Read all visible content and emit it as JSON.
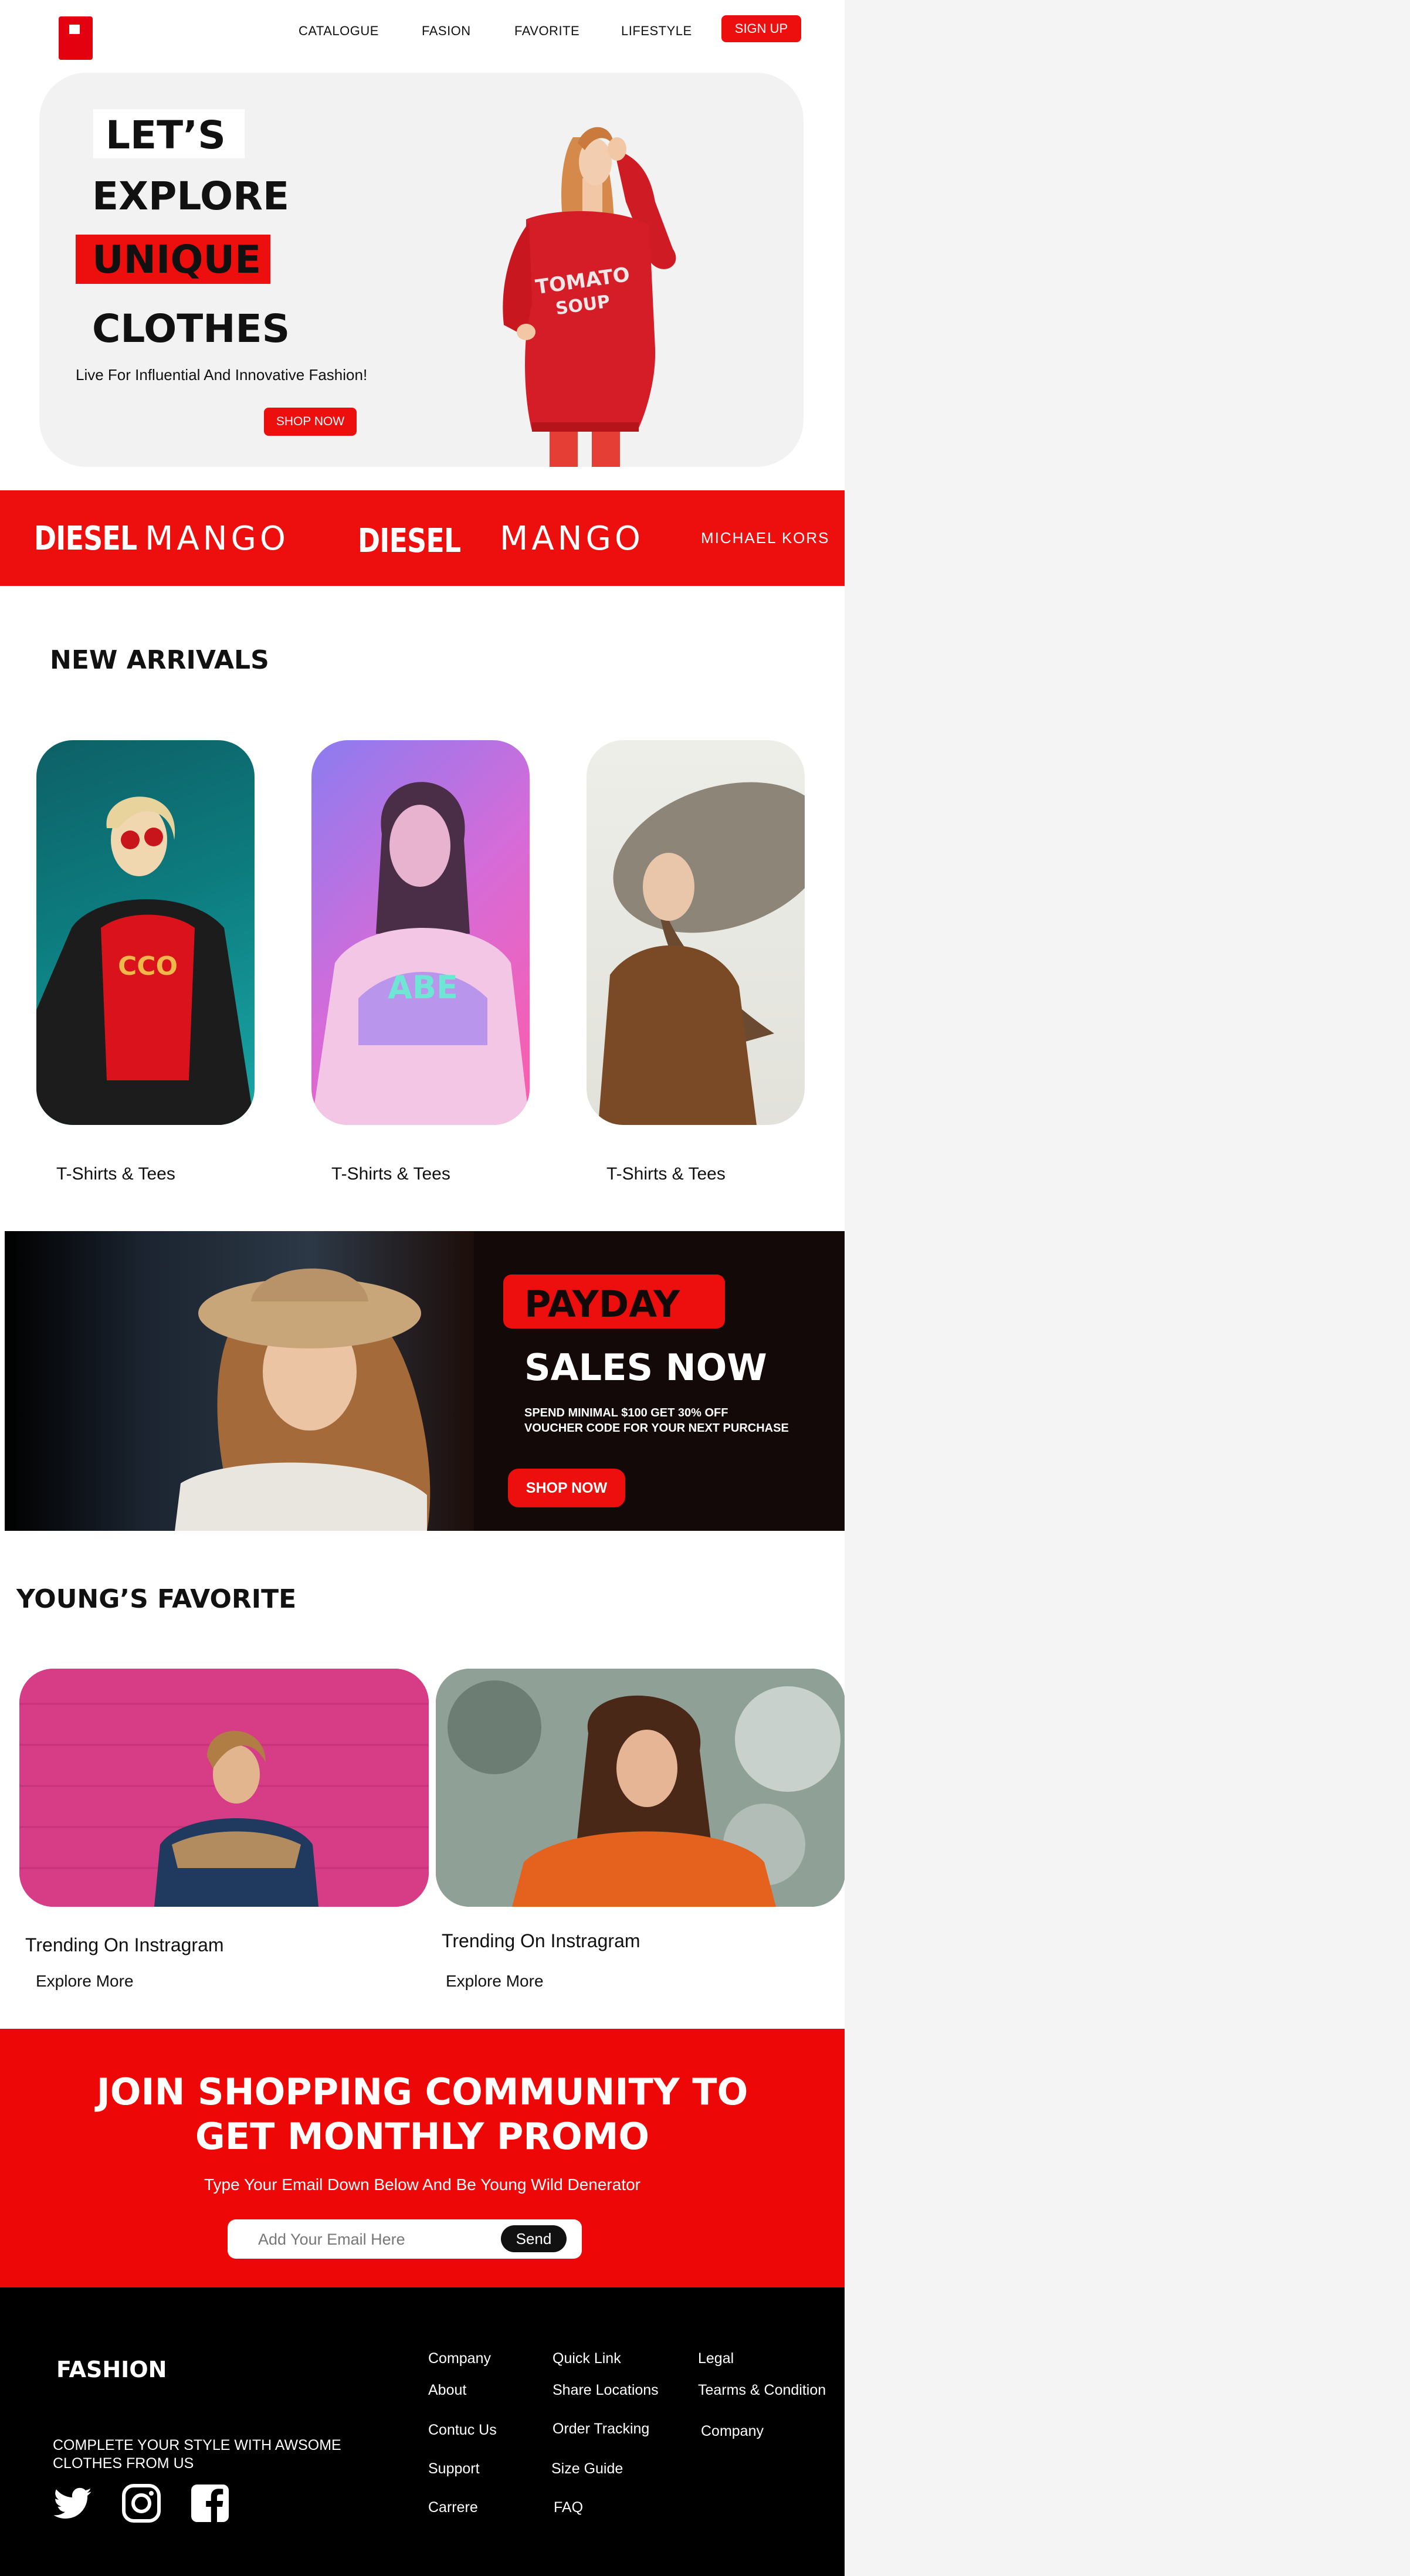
{
  "nav": {
    "items": [
      "CATALOGUE",
      "FASION",
      "FAVORITE",
      "LIFESTYLE"
    ],
    "signup": "SIGN UP"
  },
  "hero": {
    "line1": "LET’S",
    "line2": "EXPLORE",
    "line3": "UNIQUE",
    "line4": "CLOTHES",
    "subtitle": "Live For Influential And Innovative Fashion!",
    "cta": "SHOP NOW",
    "sweater_text_1": "TOMATO",
    "sweater_text_2": "SOUP"
  },
  "brands": [
    "DIESEL",
    "MANGO",
    "DIESEL",
    "MANGO",
    "MICHAEL KORS"
  ],
  "new_arrivals": {
    "title": "NEW ARRIVALS",
    "items": [
      {
        "label": "T-Shirts & Tees"
      },
      {
        "label": "T-Shirts & Tees"
      },
      {
        "label": "T-Shirts & Tees"
      }
    ]
  },
  "promo": {
    "tag": "PAYDAY",
    "headline": "SALES NOW",
    "line1": "SPEND MINIMAL $100 GET 30% OFF",
    "line2": "VOUCHER CODE FOR YOUR NEXT PURCHASE",
    "cta": "SHOP NOW"
  },
  "favorites": {
    "title": "YOUNG’S FAVORITE",
    "items": [
      {
        "label": "Trending On Instragram",
        "link": "Explore More"
      },
      {
        "label": "Trending On Instragram",
        "link": "Explore More"
      }
    ]
  },
  "newsletter": {
    "title_line1": "JOIN SHOPPING COMMUNITY TO",
    "title_line2": "GET MONTHLY PROMO",
    "subtitle": "Type Your Email Down Below And Be Young Wild Denerator",
    "placeholder": "Add Your Email Here",
    "send": "Send"
  },
  "footer": {
    "brand": "FASHION",
    "tagline": "COMPLETE YOUR STYLE WITH AWSOME CLOTHES FROM US",
    "social_icons": [
      "twitter-icon",
      "instagram-icon",
      "facebook-icon"
    ],
    "col1": [
      "Company",
      "About",
      "Contuc Us",
      "Support",
      "Carrere"
    ],
    "col2": [
      "Quick Link",
      "Share Locations",
      "Order Tracking",
      "Size Guide",
      "FAQ"
    ],
    "col3": [
      "Legal",
      "Tearms & Condition",
      "Company"
    ]
  },
  "colors": {
    "accent": "#ED0E0E",
    "dark": "#140909",
    "footer": "#000000"
  }
}
